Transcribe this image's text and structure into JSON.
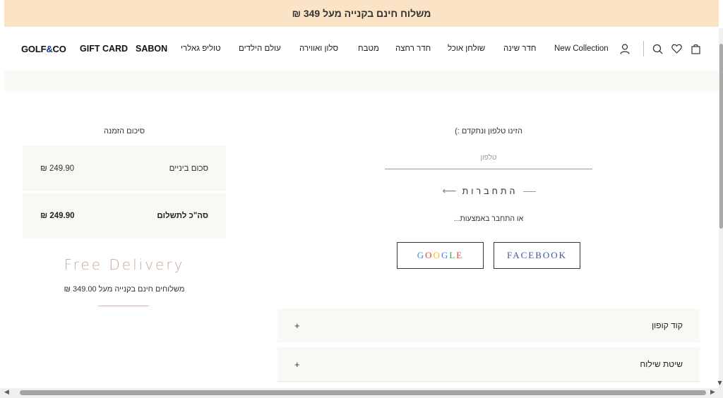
{
  "announcement": {
    "text": "משלוח חינם בקנייה מעל 349 ₪",
    "bg_color": "#fbe4c6"
  },
  "header": {
    "logo": {
      "part1": "GOLF",
      "amp": "&",
      "part2": "CO"
    },
    "nav_en": {
      "gift_card": "GIFT CARD",
      "sabon": "SABON"
    },
    "nav_he": {
      "tolip": "טוליפ גאלרי",
      "kids": "עולם הילדים",
      "salon": "סלון ואווירה",
      "kitchen": "מטבח",
      "bath": "חדר רחצה",
      "dining": "שולחן אוכל",
      "bedroom": "חדר שינה"
    },
    "new_collection": "New Collection",
    "icons": [
      "user-icon",
      "search-icon",
      "heart-icon",
      "shopping-bag-icon"
    ]
  },
  "login": {
    "title": "הזינו טלפון ונתקדם :)",
    "phone_placeholder": "טלפון",
    "connect_label": "התחברות",
    "or_text": "או התחבר באמצעות...",
    "google": "GOOGLE",
    "facebook": "FACEBOOK",
    "google_colors": [
      "#4285F4",
      "#EA4335",
      "#FBBC05",
      "#4285F4",
      "#34A853",
      "#EA4335"
    ]
  },
  "accordions": {
    "coupon": {
      "title": "קוד קופון",
      "icon": "+"
    },
    "shipping": {
      "title": "שיטת שילוח",
      "icon": "+"
    }
  },
  "summary": {
    "title": "סיכום הזמנה",
    "subtotal_label": "סכום ביניים",
    "subtotal_value": "249.90 ₪",
    "total_label": "סה\"כ לתשלום",
    "total_value": "249.90 ₪"
  },
  "free_delivery": {
    "title": "Free Delivery",
    "subtitle": "משלוחים חינם בקנייה מעל 349.00 ₪",
    "accent_color": "#c9a89a"
  }
}
